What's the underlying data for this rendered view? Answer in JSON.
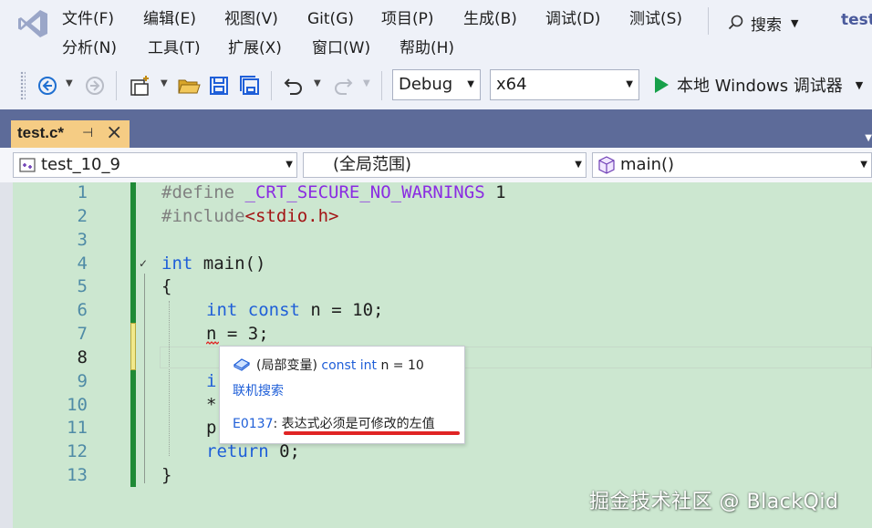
{
  "menu": {
    "row1": [
      "文件(F)",
      "编辑(E)",
      "视图(V)",
      "Git(G)",
      "项目(P)",
      "生成(B)",
      "调试(D)",
      "测试(S)"
    ],
    "row2": [
      "分析(N)",
      "工具(T)",
      "扩展(X)",
      "窗口(W)",
      "帮助(H)"
    ],
    "search_label": "搜索",
    "solution_name": "test"
  },
  "toolbar": {
    "configuration": "Debug",
    "platform": "x64",
    "run_label": "本地 Windows 调试器"
  },
  "tab": {
    "title": "test.c*"
  },
  "navbar": {
    "project": "test_10_9",
    "scope": "(全局范围)",
    "member": "main()"
  },
  "editor": {
    "line_numbers": [
      "1",
      "2",
      "3",
      "4",
      "5",
      "6",
      "7",
      "8",
      "9",
      "10",
      "11",
      "12",
      "13"
    ],
    "current_line": "8",
    "lines": {
      "l1_directive": "#define",
      "l1_macro": "_CRT_SECURE_NO_WARNINGS",
      "l1_value": " 1",
      "l2_directive": "#include",
      "l2_header": "<stdio.h>",
      "l4_kw": "int",
      "l4_rest": " main()",
      "l5": "{",
      "l6_kw1": "int",
      "l6_kw2": "const",
      "l6_rest": " n = 10;",
      "l7": "n = 3;",
      "l9": "i",
      "l10": "*",
      "l11": "p",
      "l12_kw": "return",
      "l12_rest": " 0;",
      "l13": "}"
    }
  },
  "quickinfo": {
    "scope_text": "(局部变量)",
    "decl_kw": "const int",
    "decl_rest": "n = 10",
    "online_search": "联机搜索",
    "error_code": "E0137",
    "error_message": ": 表达式必须是可修改的左值"
  },
  "watermark": "掘金技术社区 @ BlackQid",
  "colors": {
    "editor_background": "#cce7d0",
    "keyword": "#1f5fd8",
    "tab_active": "#f5cc84",
    "tab_strip": "#5d6b99",
    "change_bar": "#1f8a36",
    "error_underline": "#e02424"
  }
}
